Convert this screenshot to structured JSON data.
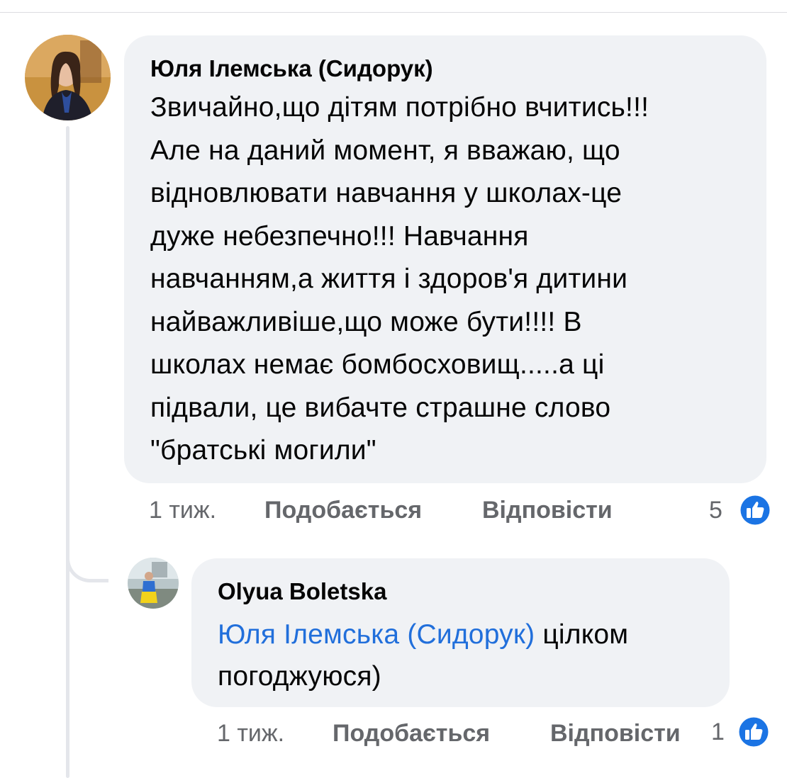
{
  "colors": {
    "bubble": "#f0f2f5",
    "text": "#050505",
    "secondary_text": "#65676b",
    "mention": "#216fdb",
    "like_badge": "#1b74e4"
  },
  "comment": {
    "author": "Юля Ілемська (Сидорук)",
    "avatar": "user-avatar-photo",
    "text_lines": [
      "Звичайно,що дітям потрібно вчитись!!!",
      "Але на даний момент, я вважаю, що",
      "відновлювати навчання у школах-це",
      "дуже небезпечно!!! Навчання",
      "навчанням,а життя і здоров'я дитини",
      "найважливіше,що може бути!!!! В",
      "школах немає бомбосховищ.....а ці",
      "підвали, це вибачте страшне слово",
      "\"братські могили\""
    ],
    "time": "1 тиж.",
    "like_label": "Подобається",
    "reply_label": "Відповісти",
    "reaction_count": "5",
    "reaction_icon": "thumbs-up-icon"
  },
  "reply": {
    "author": "Olyua Boletska",
    "avatar": "user-avatar-photo",
    "mention": "Юля Ілемська (Сидорук)",
    "text_after_mention": " цілком",
    "text_line_2": "погоджуюся)",
    "time": "1 тиж.",
    "like_label": "Подобається",
    "reply_label": "Відповісти",
    "reaction_count": "1",
    "reaction_icon": "thumbs-up-icon"
  }
}
